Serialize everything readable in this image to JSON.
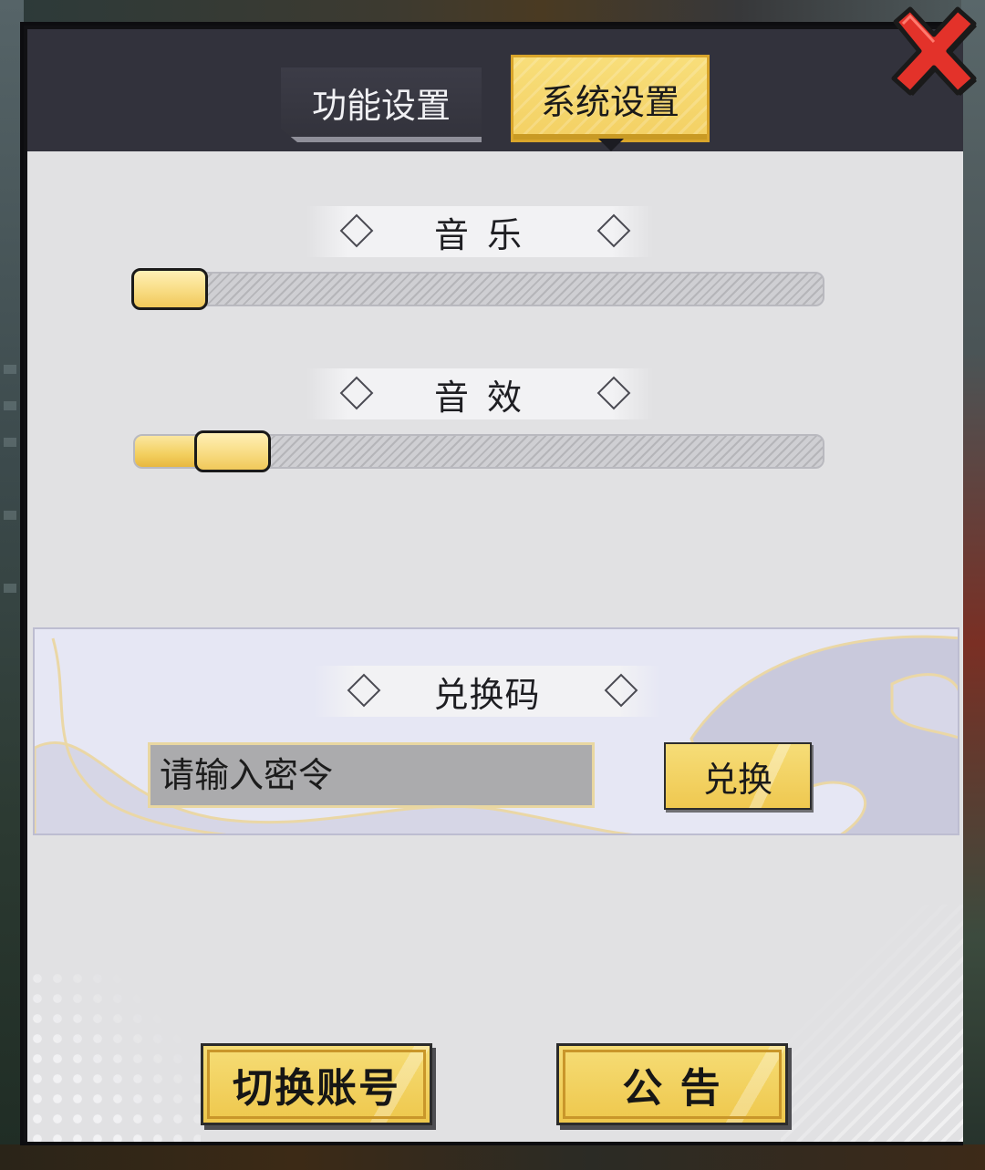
{
  "tabs": {
    "feature_settings": "功能设置",
    "system_settings": "系统设置",
    "active": "system_settings"
  },
  "audio": {
    "music": {
      "label": "音 乐",
      "level": 0
    },
    "sfx": {
      "label": "音 效",
      "level": 0.1
    }
  },
  "redeem": {
    "title": "兑换码",
    "placeholder": "请输入密令",
    "button_label": "兑换"
  },
  "footer": {
    "switch_account_label": "切换账号",
    "announcement_label": "公 告"
  },
  "colors": {
    "accent_gold": "#f3d063",
    "close_red": "#e3322a",
    "panel_header": "#32323c",
    "panel_body": "#e1e1e3"
  },
  "icons": {
    "close": "close-x-icon",
    "section_marker": "diamond-icon"
  }
}
